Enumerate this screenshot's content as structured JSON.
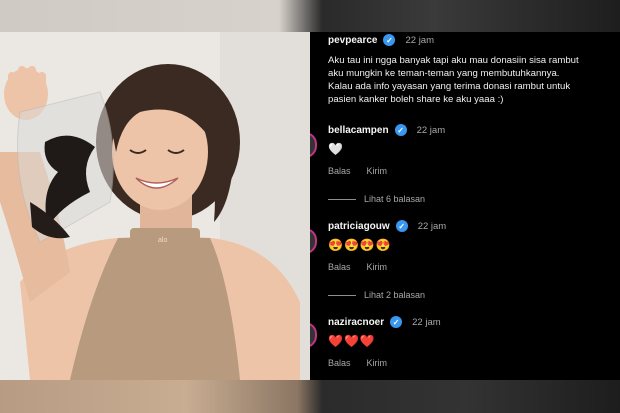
{
  "comments": [
    {
      "username": "pevpearce",
      "time": "22 jam",
      "text": "Aku tau ini ngga banyak tapi aku mau donasiin sisa rambut\naku mungkin ke teman-teman yang membutuhkannya.\nKalau ada info yayasan yang terima donasi rambut untuk\npasien kanker boleh share ke aku yaaa :)"
    },
    {
      "username": "bellacampen",
      "time": "22 jam",
      "text": "🤍",
      "reply": "Balas",
      "send": "Kirim",
      "view_replies": "Lihat 6 balasan"
    },
    {
      "username": "patriciagouw",
      "time": "22 jam",
      "text": "😍😍😍😍",
      "reply": "Balas",
      "send": "Kirim",
      "view_replies": "Lihat 2 balasan"
    },
    {
      "username": "naziracnoer",
      "time": "22 jam",
      "text": "❤️❤️❤️",
      "reply": "Balas",
      "send": "Kirim"
    }
  ],
  "photo": {
    "shirt_logo": "alo"
  },
  "colors": {
    "verified": "#3897f0",
    "background": "#000000",
    "muted_text": "#a8a8a8"
  }
}
